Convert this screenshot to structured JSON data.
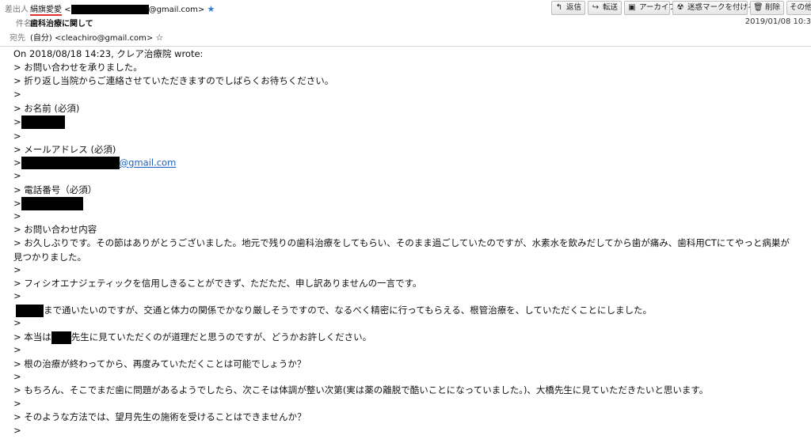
{
  "header": {
    "from_label": "差出人",
    "from_name": "絹旗愛愛",
    "from_email_open": "<",
    "from_email_domain": "@gmail.com>",
    "subject_label": "件名",
    "subject": "歯科治療に関して",
    "to_label": "宛先",
    "to_value": "(自分) <cleachiro@gmail.com>",
    "date": "2019/01/08 10:3"
  },
  "toolbar": {
    "reply": "返信",
    "forward": "転送",
    "archive": "アーカイブ",
    "junk": "迷惑マークを付ける",
    "delete": "削除",
    "more": "その他"
  },
  "icons": {
    "star_filled": "★",
    "star_outline": "☆",
    "reply": "↰",
    "forward": "↪",
    "archive": "▣",
    "junk": "☢",
    "delete": "🗑",
    "more": "▾"
  },
  "body": {
    "quote_header": "On 2018/08/18 14:23, クレア治療院 wrote:",
    "l1": "> お問い合わせを承りました。",
    "l2": "> 折り返し当院からご連絡させていただきますのでしばらくお待ちください。",
    "gt": ">",
    "name_label": "> お名前 (必須)",
    "email_label": "> メールアドレス (必須)",
    "email_domain": "@gmail.com",
    "phone_label": "> 電話番号（必須）",
    "inquiry_label": "> お問い合わせ内容",
    "inquiry_p1a": "> お久しぶりです。その節はありがとうございました。地元で残りの歯科治療をしてもらい、そのまま過ごしていたのですが、水素水を飲みだしてから歯が痛み、歯科用CTにてやっと病巣が",
    "inquiry_p1b": "見つかりました。",
    "inquiry_p2": "> フィシオエナジェティックを信用しきることができず、ただただ、申し訳ありませんの一言です。",
    "inquiry_p3": "まで通いたいのですが、交通と体力の関係でかなり厳しそうですので、なるべく精密に行ってもらえる、根管治療を、していただくことにしました。",
    "inquiry_p4a": "> 本当は",
    "inquiry_p4b": "先生に見ていただくのが道理だと思うのですが、どうかお許しください。",
    "inquiry_p5": "> 根の治療が終わってから、再度みていただくことは可能でしょうか？",
    "inquiry_p6": "> もちろん、そこでまだ歯に問題があるようでしたら、次こそは体調が整い次第(実は薬の離脱で酷いことになっていました。)、大橋先生に見ていただきたいと思います。",
    "inquiry_p7": "> そのような方法では、望月先生の施術を受けることはできませんか？"
  }
}
